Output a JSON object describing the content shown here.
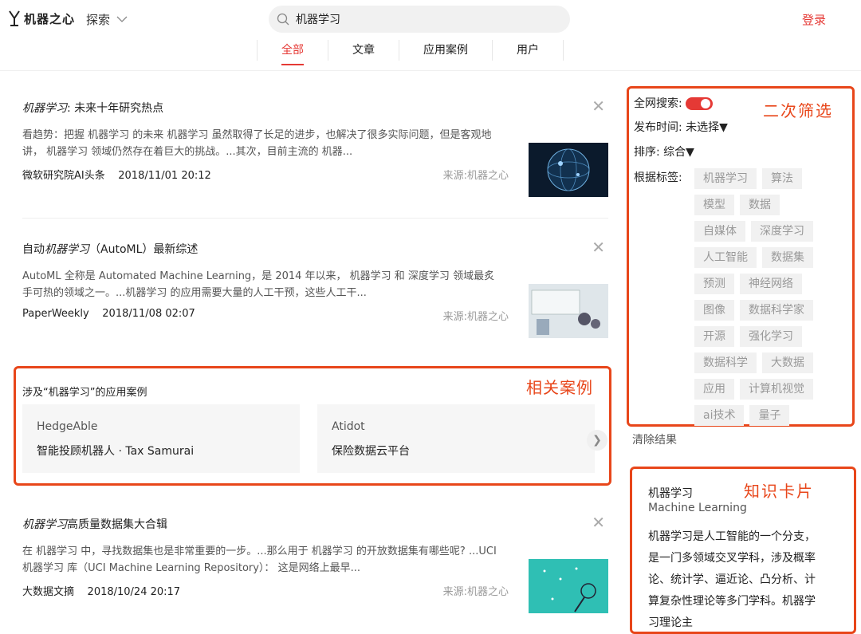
{
  "header": {
    "brand": "机器之心",
    "explore_label": "探索",
    "search_value": "机器学习",
    "login_label": "登录"
  },
  "tabs": [
    {
      "label": "全部",
      "active": true
    },
    {
      "label": "文章",
      "active": false
    },
    {
      "label": "应用案例",
      "active": false
    },
    {
      "label": "用户",
      "active": false
    }
  ],
  "articles": [
    {
      "title_em": "机器学习",
      "title_rest": ": 未来十年研究热点",
      "snippet": "看趋势：把握 机器学习 的未来 机器学习 虽然取得了长足的进步，也解决了很多实际问题，但是客观地讲， 机器学习 领域仍然存在着巨大的挑战。...其次，目前主流的 机器...",
      "author": "微软研究院AI头条",
      "date": "2018/11/01 20:12",
      "source": "来源:机器之心"
    },
    {
      "title_pre": "自动",
      "title_em": "机器学习",
      "title_rest": "（AutoML）最新综述",
      "snippet": "AutoML 全称是 Automated Machine Learning，是 2014 年以来， 机器学习 和 深度学习 领域最炙手可热的领域之一。...机器学习 的应用需要大量的人工干预，这些人工干...",
      "author": "PaperWeekly",
      "date": "2018/11/08 02:07",
      "source": "来源:机器之心"
    },
    {
      "title_em": "机器学习",
      "title_rest": "高质量数据集大合辑",
      "snippet": "在 机器学习 中，寻找数据集也是非常重要的一步。...那么用于 机器学习 的开放数据集有哪些呢? ...UCI 机器学习 库（UCI Machine Learning Repository）： 这是网络上最早...",
      "author": "大数据文摘",
      "date": "2018/10/24 20:17",
      "source": "来源:机器之心"
    }
  ],
  "cases": {
    "title": "涉及“机器学习”的应用案例",
    "annotation": "相关案例",
    "items": [
      {
        "name": "HedgeAble",
        "desc": "智能投顾机器人 · Tax Samurai"
      },
      {
        "name": "Atidot",
        "desc": "保险数据云平台"
      }
    ]
  },
  "filter": {
    "annotation": "二次筛选",
    "global_search_label": "全网搜索:",
    "global_search_on": true,
    "time_label": "发布时间:",
    "time_value": "未选择▼",
    "sort_label": "排序:",
    "sort_value": "综合▼",
    "tags_label": "根据标签:",
    "tags": [
      "机器学习",
      "算法",
      "模型",
      "数据",
      "自媒体",
      "深度学习",
      "人工智能",
      "数据集",
      "预测",
      "神经网络",
      "图像",
      "数据科学家",
      "开源",
      "强化学习",
      "数据科学",
      "大数据",
      "应用",
      "计算机视觉",
      "ai技术",
      "量子"
    ],
    "clear_label": "清除结果"
  },
  "knowledge": {
    "annotation": "知识卡片",
    "title": "机器学习",
    "english": "Machine Learning",
    "desc": "机器学习是人工智能的一个分支，是一门多领域交叉学科，涉及概率论、统计学、逼近论、凸分析、计算复杂性理论等多门学科。机器学习理论主"
  },
  "colors": {
    "accent": "#e53935",
    "annotation": "#e8461a"
  }
}
